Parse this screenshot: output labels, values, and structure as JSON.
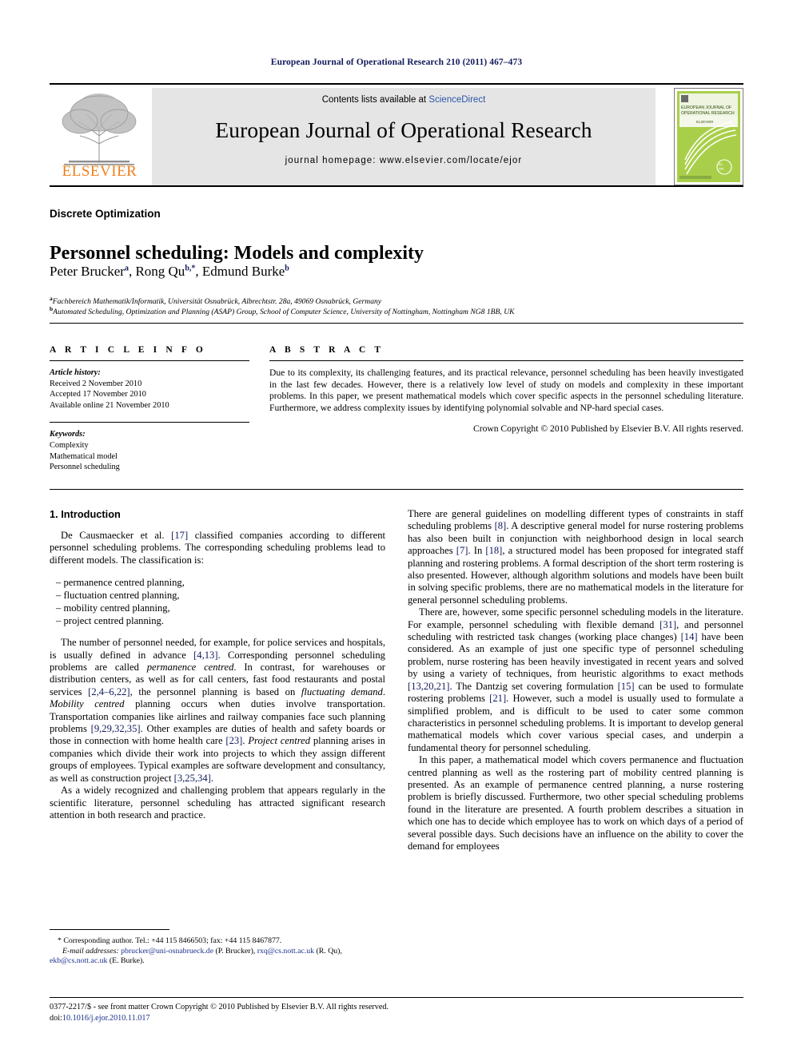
{
  "running_head": "European Journal of Operational Research 210 (2011) 467–473",
  "masthead": {
    "publisher_wordmark": "ELSEVIER",
    "contents_prefix": "Contents lists available at ",
    "contents_link": "ScienceDirect",
    "journal_title": "European Journal of Operational Research",
    "homepage": "journal homepage: www.elsevier.com/locate/ejor",
    "cover_title_line1": "EUROPEAN JOURNAL OF",
    "cover_title_line2": "OPERATIONAL RESEARCH",
    "cover_logo_text": "EJOR",
    "cover_green": "#8cc63e",
    "link_color": "#2a56a8",
    "elsevier_orange": "#f07f1a"
  },
  "article": {
    "section_flag": "Discrete Optimization",
    "title": "Personnel scheduling: Models and complexity",
    "authors": [
      {
        "name": "Peter Brucker",
        "marks": "a"
      },
      {
        "name": "Rong Qu",
        "marks": "b,*"
      },
      {
        "name": "Edmund Burke",
        "marks": "b"
      }
    ],
    "affiliations": [
      {
        "mark": "a",
        "text": "Fachbereich Mathematik/Informatik, Universität Osnabrück, Albrechtstr. 28a, 49069 Osnabrück, Germany"
      },
      {
        "mark": "b",
        "text": "Automated Scheduling, Optimization and Planning (ASAP) Group, School of Computer Science, University of Nottingham, Nottingham NG8 1BB, UK"
      }
    ]
  },
  "info": {
    "heading": "A R T I C L E    I N F O",
    "history_label": "Article history:",
    "history": [
      "Received 2 November 2010",
      "Accepted 17 November 2010",
      "Available online 21 November 2010"
    ],
    "keywords_label": "Keywords:",
    "keywords": [
      "Complexity",
      "Mathematical model",
      "Personnel scheduling"
    ]
  },
  "abstract": {
    "heading": "A B S T R A C T",
    "text": "Due to its complexity, its challenging features, and its practical relevance, personnel scheduling has been heavily investigated in the last few decades. However, there is a relatively low level of study on models and complexity in these important problems. In this paper, we present mathematical models which cover specific aspects in the personnel scheduling literature. Furthermore, we address complexity issues by identifying polynomial solvable and NP-hard special cases.",
    "copyright": "Crown Copyright © 2010 Published by Elsevier B.V. All rights reserved."
  },
  "body": {
    "section_number_title": "1. Introduction",
    "left": {
      "p1_a": "De Causmaecker et al. ",
      "p1_ref": "[17]",
      "p1_b": " classified companies according to different personnel scheduling problems. The corresponding scheduling problems lead to different models. The classification is:",
      "list": [
        "permanence centred planning,",
        "fluctuation centred planning,",
        "mobility centred planning,",
        "project centred planning."
      ],
      "p2_parts": [
        {
          "t": "The number of personnel needed, for example, for police services and hospitals, is usually defined in advance ",
          "s": "plain"
        },
        {
          "t": "[4,13]",
          "s": "ref"
        },
        {
          "t": ". Corresponding personnel scheduling problems are called ",
          "s": "plain"
        },
        {
          "t": "permanence centred",
          "s": "ital"
        },
        {
          "t": ". In contrast, for warehouses or distribution centers, as well as for call centers, fast food restaurants and postal services ",
          "s": "plain"
        },
        {
          "t": "[2,4–6,22]",
          "s": "ref"
        },
        {
          "t": ", the personnel planning is based on ",
          "s": "plain"
        },
        {
          "t": "fluctuating demand",
          "s": "ital"
        },
        {
          "t": ". ",
          "s": "plain"
        },
        {
          "t": "Mobility centred",
          "s": "ital"
        },
        {
          "t": " planning occurs when duties involve transportation. Transportation companies like airlines and railway companies face such planning problems ",
          "s": "plain"
        },
        {
          "t": "[9,29,32,35]",
          "s": "ref"
        },
        {
          "t": ". Other examples are duties of health and safety boards or those in connection with home health care ",
          "s": "plain"
        },
        {
          "t": "[23]",
          "s": "ref"
        },
        {
          "t": ". ",
          "s": "plain"
        },
        {
          "t": "Project centred",
          "s": "ital"
        },
        {
          "t": " planning arises in companies which divide their work into projects to which they assign different groups of employees. Typical examples are software development and consultancy, as well as construction project ",
          "s": "plain"
        },
        {
          "t": "[3,25,34]",
          "s": "ref"
        },
        {
          "t": ".",
          "s": "plain"
        }
      ],
      "p3": "As a widely recognized and challenging problem that appears regularly in the scientific literature, personnel scheduling has attracted significant research attention in both research and practice."
    },
    "right": {
      "p1_parts": [
        {
          "t": "There are general guidelines on modelling different types of constraints in staff scheduling problems ",
          "s": "plain"
        },
        {
          "t": "[8]",
          "s": "ref"
        },
        {
          "t": ". A descriptive general model for nurse rostering problems has also been built in conjunction with neighborhood design in local search approaches ",
          "s": "plain"
        },
        {
          "t": "[7]",
          "s": "ref"
        },
        {
          "t": ". In ",
          "s": "plain"
        },
        {
          "t": "[18]",
          "s": "ref"
        },
        {
          "t": ", a structured model has been proposed for integrated staff planning and rostering problems. A formal description of the short term rostering is also presented. However, although algorithm solutions and models have been built in solving specific problems, there are no mathematical models in the literature for general personnel scheduling problems.",
          "s": "plain"
        }
      ],
      "p2_parts": [
        {
          "t": "There are, however, some specific personnel scheduling models in the literature. For example, personnel scheduling with flexible demand ",
          "s": "plain"
        },
        {
          "t": "[31]",
          "s": "ref"
        },
        {
          "t": ", and personnel scheduling with restricted task changes (working place changes) ",
          "s": "plain"
        },
        {
          "t": "[14]",
          "s": "ref"
        },
        {
          "t": " have been considered. As an example of just one specific type of personnel scheduling problem, nurse rostering has been heavily investigated in recent years and solved by using a variety of techniques, from heuristic algorithms to exact methods ",
          "s": "plain"
        },
        {
          "t": "[13,20,21]",
          "s": "ref"
        },
        {
          "t": ". The Dantzig set covering formulation ",
          "s": "plain"
        },
        {
          "t": "[15]",
          "s": "ref"
        },
        {
          "t": " can be used to formulate rostering problems ",
          "s": "plain"
        },
        {
          "t": "[21]",
          "s": "ref"
        },
        {
          "t": ". However, such a model is usually used to formulate a simplified problem, and is difficult to be used to cater some common characteristics in personnel scheduling problems. It is important to develop general mathematical models which cover various special cases, and underpin a fundamental theory for personnel scheduling.",
          "s": "plain"
        }
      ],
      "p3": "In this paper, a mathematical model which covers permanence and fluctuation centred planning as well as the rostering part of mobility centred planning is presented. As an example of permanence centred planning, a nurse rostering problem is briefly discussed. Furthermore, two other special scheduling problems found in the literature are presented. A fourth problem describes a situation in which one has to decide which employee has to work on which days of a period of several possible days. Such decisions have an influence on the ability to cover the demand for employees"
    }
  },
  "footnote": {
    "corresponding": "* Corresponding author. Tel.: +44 115 8466503; fax: +44 115 8467877.",
    "email_label": "E-mail addresses:",
    "emails": [
      {
        "address": "pbrucker@uni-osnabrueck.de",
        "person": " (P. Brucker), "
      },
      {
        "address": "rxq@cs.nott.ac.uk",
        "person": " (R. Qu), "
      },
      {
        "address": "ekb@cs.nott.ac.uk",
        "person": " (E. Burke)."
      }
    ]
  },
  "imprint": {
    "line1": "0377-2217/$ - see front matter Crown Copyright © 2010 Published by Elsevier B.V. All rights reserved.",
    "doi_label": "doi:",
    "doi": "10.1016/j.ejor.2010.11.017"
  }
}
